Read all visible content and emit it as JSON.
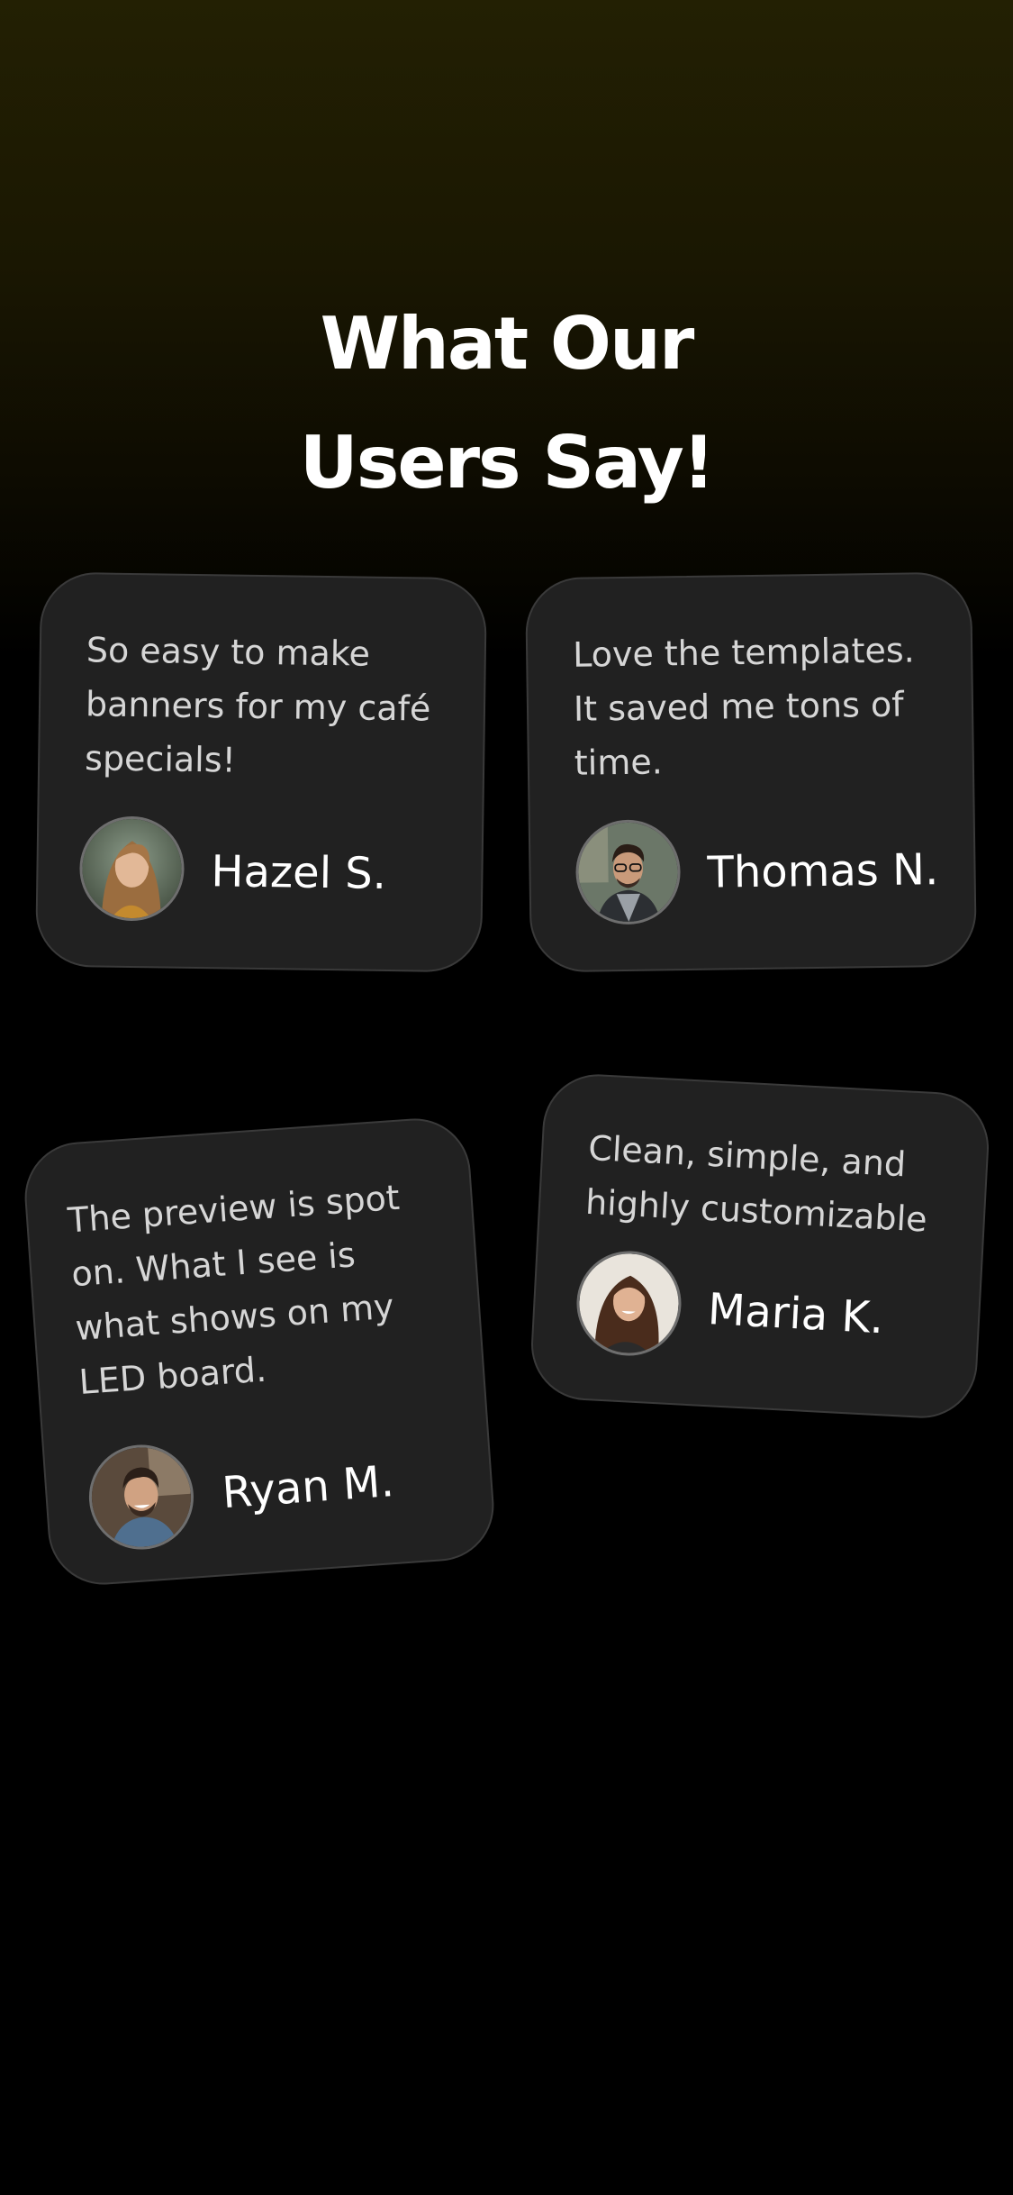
{
  "header": {
    "title_line1": "What Our",
    "title_line2": "Users Say!"
  },
  "testimonials": [
    {
      "quote": "So easy to make\nbanners for my café\nspecials!",
      "name": "Hazel S.",
      "avatar": "user-photo-hazel"
    },
    {
      "quote": "Love the templates.\nIt saved me tons of\ntime.",
      "name": "Thomas N.",
      "avatar": "user-photo-thomas"
    },
    {
      "quote": "The preview is spot\non. What I see is\nwhat shows on my\nLED board.",
      "name": "Ryan M.",
      "avatar": "user-photo-ryan"
    },
    {
      "quote": "Clean, simple, and\nhighly customizable",
      "name": "Maria K.",
      "avatar": "user-photo-maria"
    }
  ],
  "colors": {
    "background_top": "#232003",
    "background_bottom": "#000000",
    "card_background": "#212121",
    "card_border": "#3a3a3a",
    "quote_text": "#d6d6d6",
    "name_text": "#ffffff"
  }
}
